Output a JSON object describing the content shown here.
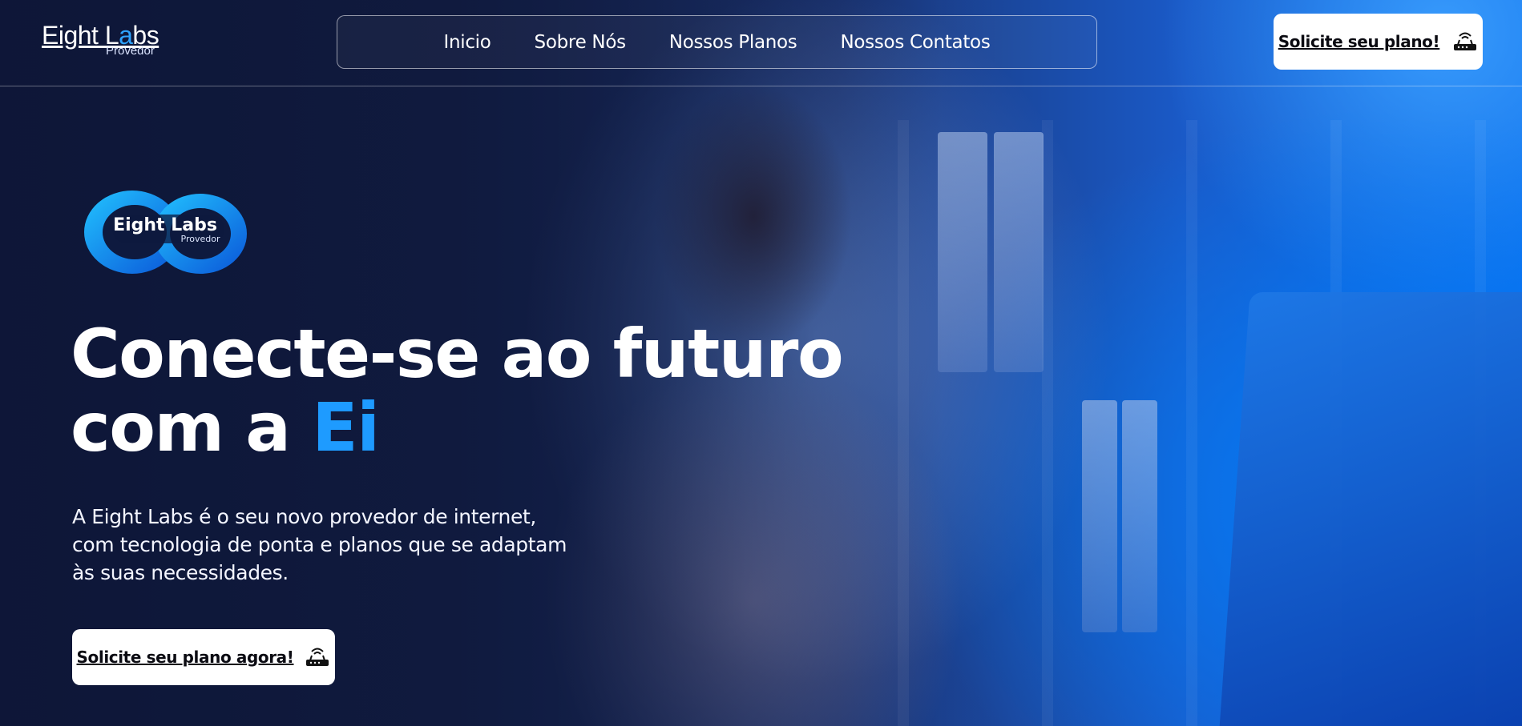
{
  "brand": {
    "name_part1": "Eight L",
    "name_accent": "a",
    "name_part2": "bs",
    "tagline": "Provedor"
  },
  "nav": {
    "items": [
      {
        "label": "Inicio"
      },
      {
        "label": "Sobre Nós"
      },
      {
        "label": "Nossos Planos"
      },
      {
        "label": "Nossos Contatos"
      }
    ]
  },
  "header_cta": {
    "label": "Solicite seu plano!",
    "icon": "router-icon"
  },
  "hero": {
    "logo": {
      "text": "Eight Labs",
      "subtext": "Provedor",
      "colors": [
        "#16b5ff",
        "#0a4fd6"
      ]
    },
    "headline_line1": "Conecte-se ao futuro",
    "headline_line2_prefix": "com a ",
    "headline_accent": "Ei",
    "subtext": "A Eight Labs é o seu novo provedor de internet, com tecnologia de ponta e planos que se adaptam às suas necessidades.",
    "cta": {
      "label": "Solicite seu plano agora!",
      "icon": "router-icon"
    }
  },
  "colors": {
    "accent": "#1e9bff",
    "background_dark": "#0e1a3f",
    "background_blue": "#0a6ae8",
    "button_bg": "#ffffff",
    "button_text": "#0b0b12"
  }
}
